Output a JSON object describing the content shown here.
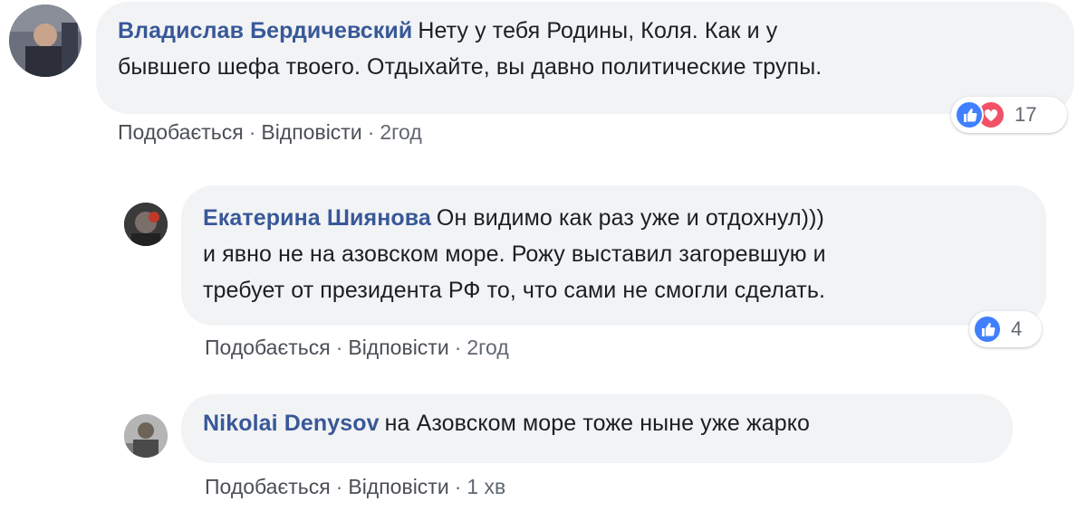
{
  "comments": [
    {
      "author": "Владислав Бердичевский",
      "text_line1": "Нету у тебя Родины, Коля. Как и у",
      "text_line2": "бывшего шефа твоего. Отдыхайте, вы давно политические трупы.",
      "actions": {
        "like": "Подобається",
        "reply": "Відповісти",
        "sep": "·",
        "time": "2год"
      },
      "reactions": {
        "icons": [
          "like-icon",
          "love-icon"
        ],
        "count": "17"
      }
    },
    {
      "author": "Екатерина Шиянова",
      "text_line1": "Он видимо как раз уже и отдохнул)))",
      "text_line2": "и явно не на азовском море. Рожу выставил загоревшую и",
      "text_line3": "требует от президента РФ то, что сами не смогли сделать.",
      "actions": {
        "like": "Подобається",
        "reply": "Відповісти",
        "sep": "·",
        "time": "2год"
      },
      "reactions": {
        "icons": [
          "like-icon"
        ],
        "count": "4"
      }
    },
    {
      "author": "Nikolai Denysov",
      "text_line1": "на Азовском море тоже ныне уже жарко",
      "actions": {
        "like": "Подобається",
        "reply": "Відповісти",
        "sep": "·",
        "time": "1 хв"
      }
    }
  ],
  "colors": {
    "bubble": "#f2f3f5",
    "author": "#385898",
    "like": "#4080ff",
    "love": "#f25268",
    "meta": "#606770"
  }
}
